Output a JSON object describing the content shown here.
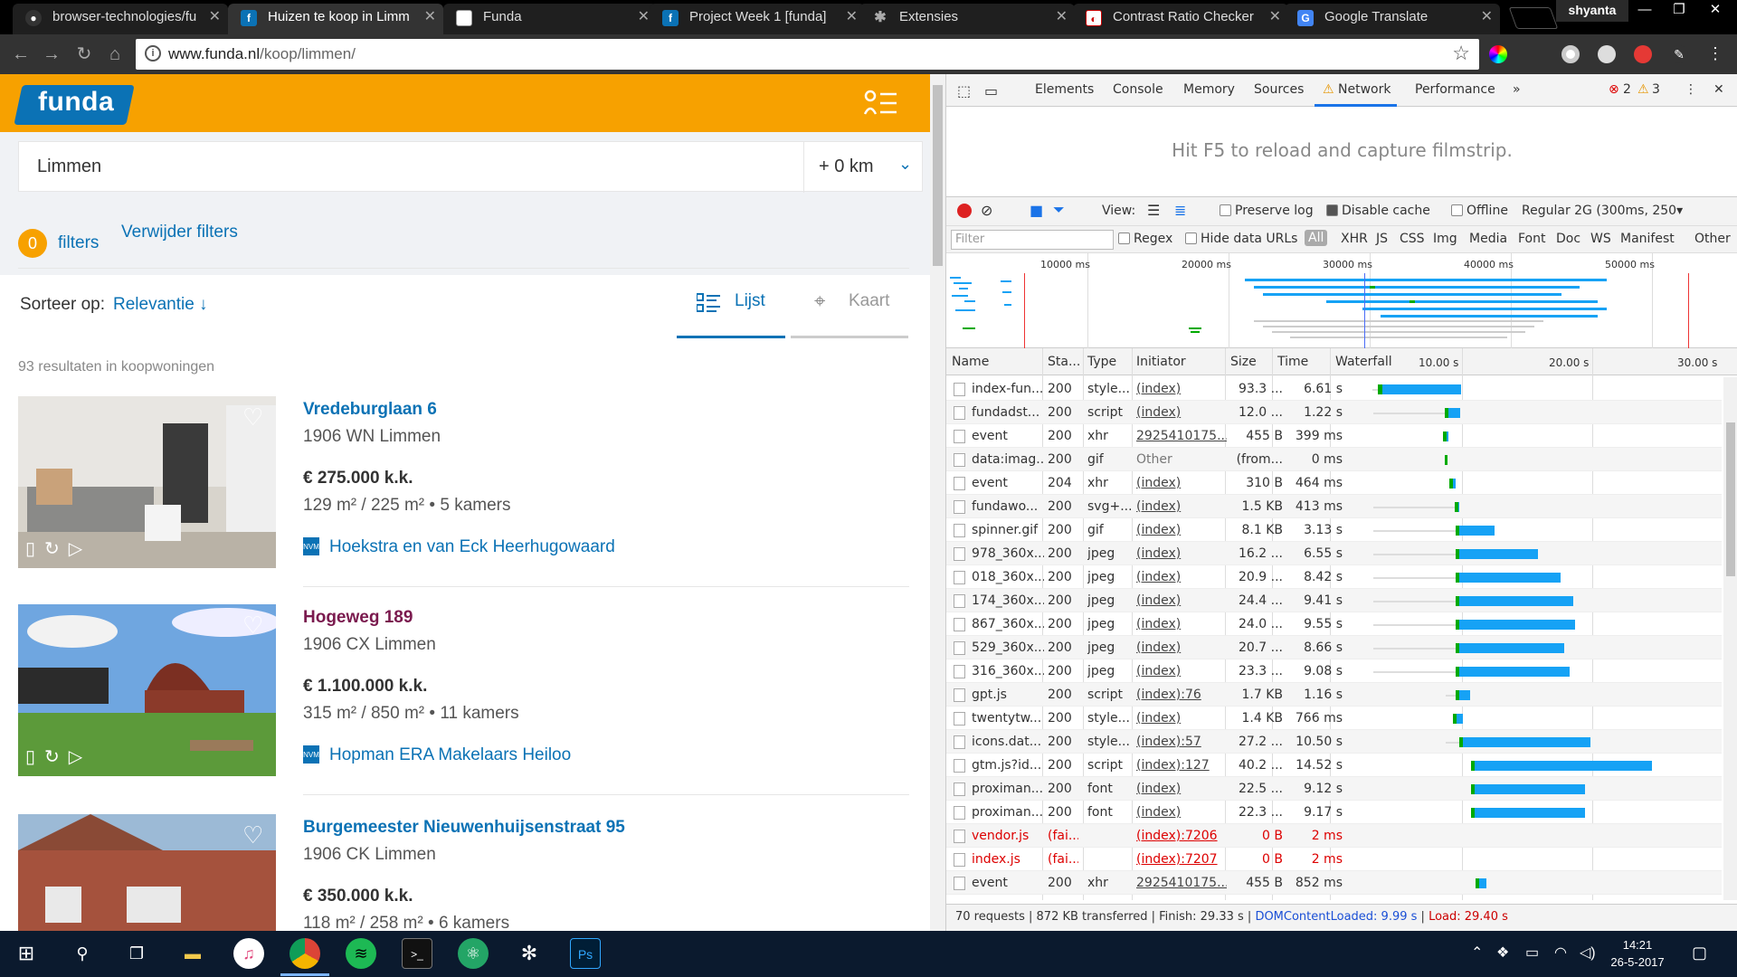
{
  "browser": {
    "tabs": [
      {
        "title": "browser-technologies/fu",
        "icon": "github-icon",
        "active": false
      },
      {
        "title": "Huizen te koop in Limm",
        "icon": "funda-icon",
        "active": true
      },
      {
        "title": "Funda",
        "icon": "page-icon",
        "active": false
      },
      {
        "title": "Project Week 1 [funda]",
        "icon": "funda-icon",
        "active": false
      },
      {
        "title": "Extensies",
        "icon": "puzzle-icon",
        "active": false
      },
      {
        "title": "Contrast Ratio Checker",
        "icon": "contrast-icon",
        "active": false
      },
      {
        "title": "Google Translate",
        "icon": "translate-icon",
        "active": false
      }
    ],
    "profile": "shyanta",
    "url_host": "www.funda.nl",
    "url_path": "/koop/limmen/"
  },
  "funda": {
    "logo": "funda",
    "search_location": "Limmen",
    "radius": "+ 0 km",
    "filter_count": "0",
    "filters_label": "filters",
    "remove_filters": "Verwijder filters",
    "sort_label": "Sorteer op:",
    "sort_value": "Relevantie ↓",
    "view_list": "Lijst",
    "view_map": "Kaart",
    "results": "93 resultaten in koopwoningen",
    "listings": [
      {
        "address": "Vredeburglaan 6",
        "zip": "1906 WN Limmen",
        "price": "€ 275.000 k.k.",
        "living": "129 m²",
        "plot": "225 m²",
        "rooms": "5 kamers",
        "agent": "Hoekstra en van Eck Heerhugowaard",
        "visited": false
      },
      {
        "address": "Hogeweg 189",
        "zip": "1906 CX Limmen",
        "price": "€ 1.100.000 k.k.",
        "living": "315 m²",
        "plot": "850 m²",
        "rooms": "11 kamers",
        "agent": "Hopman ERA Makelaars Heiloo",
        "visited": true
      },
      {
        "address": "Burgemeester Nieuwenhuijsenstraat 95",
        "zip": "1906 CK Limmen",
        "price": "€ 350.000 k.k.",
        "living": "118 m²",
        "plot": "258 m²",
        "rooms": "6 kamers",
        "agent": "",
        "visited": false
      }
    ]
  },
  "devtools": {
    "tabs": [
      "Elements",
      "Console",
      "Memory",
      "Sources",
      "Network",
      "Performance"
    ],
    "active_tab": "Network",
    "errors": "2",
    "warnings": "3",
    "filmstrip_msg": "Hit F5 to reload and capture filmstrip.",
    "toolbar": {
      "view_label": "View:",
      "preserve_log": "Preserve log",
      "disable_cache": "Disable cache",
      "offline": "Offline",
      "throttle": "Regular 2G (300ms, 250"
    },
    "filterbar": {
      "placeholder": "Filter",
      "regex": "Regex",
      "hide_data_urls": "Hide data URLs",
      "types": [
        "All",
        "XHR",
        "JS",
        "CSS",
        "Img",
        "Media",
        "Font",
        "Doc",
        "WS",
        "Manifest",
        "Other"
      ]
    },
    "overview_ticks": [
      "10000 ms",
      "20000 ms",
      "30000 ms",
      "40000 ms",
      "50000 ms"
    ],
    "columns": [
      "Name",
      "Sta...",
      "Type",
      "Initiator",
      "Size",
      "Time",
      "Waterfall"
    ],
    "waterfall_ticks": [
      "10.00 s",
      "20.00 s",
      "30.00 s"
    ],
    "requests": [
      {
        "name": "index-fun...",
        "status": "200",
        "type": "style...",
        "initiator": "(index)",
        "size": "93.3 ...",
        "time": "6.61 s",
        "start": 2.5,
        "wait": 0.5,
        "dur": 6.61,
        "failed": false
      },
      {
        "name": "fundadst...",
        "status": "200",
        "type": "script",
        "initiator": "(index)",
        "size": "12.0 ...",
        "time": "1.22 s",
        "start": 2.6,
        "wait": 5.7,
        "dur": 1.22,
        "failed": false
      },
      {
        "name": "event",
        "status": "200",
        "type": "xhr",
        "initiator": "2925410175...",
        "size": "455 B",
        "time": "399 ms",
        "start": 8.2,
        "wait": 0,
        "dur": 0.4,
        "failed": false
      },
      {
        "name": "data:imag...",
        "status": "200",
        "type": "gif",
        "initiator": "Other",
        "size": "(from...",
        "time": "0 ms",
        "start": 8.3,
        "wait": 0,
        "dur": 0.1,
        "failed": false
      },
      {
        "name": "event",
        "status": "204",
        "type": "xhr",
        "initiator": "(index)",
        "size": "310 B",
        "time": "464 ms",
        "start": 8.7,
        "wait": 0,
        "dur": 0.46,
        "failed": false
      },
      {
        "name": "fundawo...",
        "status": "200",
        "type": "svg+...",
        "initiator": "(index)",
        "size": "1.5 KB",
        "time": "413 ms",
        "start": 2.6,
        "wait": 6.5,
        "dur": 0.41,
        "failed": false
      },
      {
        "name": "spinner.gif",
        "status": "200",
        "type": "gif",
        "initiator": "(index)",
        "size": "8.1 KB",
        "time": "3.13 s",
        "start": 2.6,
        "wait": 6.6,
        "dur": 3.13,
        "failed": false
      },
      {
        "name": "978_360x...",
        "status": "200",
        "type": "jpeg",
        "initiator": "(index)",
        "size": "16.2 ...",
        "time": "6.55 s",
        "start": 2.6,
        "wait": 6.6,
        "dur": 6.55,
        "failed": false
      },
      {
        "name": "018_360x...",
        "status": "200",
        "type": "jpeg",
        "initiator": "(index)",
        "size": "20.9 ...",
        "time": "8.42 s",
        "start": 2.6,
        "wait": 6.6,
        "dur": 8.42,
        "failed": false
      },
      {
        "name": "174_360x...",
        "status": "200",
        "type": "jpeg",
        "initiator": "(index)",
        "size": "24.4 ...",
        "time": "9.41 s",
        "start": 2.6,
        "wait": 6.6,
        "dur": 9.41,
        "failed": false
      },
      {
        "name": "867_360x...",
        "status": "200",
        "type": "jpeg",
        "initiator": "(index)",
        "size": "24.0 ...",
        "time": "9.55 s",
        "start": 2.6,
        "wait": 6.6,
        "dur": 9.55,
        "failed": false
      },
      {
        "name": "529_360x...",
        "status": "200",
        "type": "jpeg",
        "initiator": "(index)",
        "size": "20.7 ...",
        "time": "8.66 s",
        "start": 2.6,
        "wait": 6.6,
        "dur": 8.66,
        "failed": false
      },
      {
        "name": "316_360x...",
        "status": "200",
        "type": "jpeg",
        "initiator": "(index)",
        "size": "23.3 ...",
        "time": "9.08 s",
        "start": 2.6,
        "wait": 6.6,
        "dur": 9.08,
        "failed": false
      },
      {
        "name": "gpt.js",
        "status": "200",
        "type": "script",
        "initiator": "(index):76",
        "size": "1.7 KB",
        "time": "1.16 s",
        "start": 8.4,
        "wait": 0.8,
        "dur": 1.16,
        "failed": false
      },
      {
        "name": "twentytw...",
        "status": "200",
        "type": "style...",
        "initiator": "(index)",
        "size": "1.4 KB",
        "time": "766 ms",
        "start": 9.0,
        "wait": 0,
        "dur": 0.77,
        "failed": false
      },
      {
        "name": "icons.dat...",
        "status": "200",
        "type": "style...",
        "initiator": "(index):57",
        "size": "27.2 ...",
        "time": "10.50 s",
        "start": 8.4,
        "wait": 1.1,
        "dur": 10.5,
        "failed": false
      },
      {
        "name": "gtm.js?id...",
        "status": "200",
        "type": "script",
        "initiator": "(index):127",
        "size": "40.2 ...",
        "time": "14.52 s",
        "start": 10.4,
        "wait": 0,
        "dur": 14.52,
        "failed": false
      },
      {
        "name": "proximan...",
        "status": "200",
        "type": "font",
        "initiator": "(index)",
        "size": "22.5 ...",
        "time": "9.12 s",
        "start": 10.4,
        "wait": 0,
        "dur": 9.12,
        "failed": false
      },
      {
        "name": "proximan...",
        "status": "200",
        "type": "font",
        "initiator": "(index)",
        "size": "22.3 ...",
        "time": "9.17 s",
        "start": 10.4,
        "wait": 0,
        "dur": 9.17,
        "failed": false
      },
      {
        "name": "vendor.js",
        "status": "(fai...",
        "type": "",
        "initiator": "(index):7206",
        "size": "0 B",
        "time": "2 ms",
        "start": 0,
        "wait": 0,
        "dur": 0,
        "failed": true
      },
      {
        "name": "index.js",
        "status": "(fai...",
        "type": "",
        "initiator": "(index):7207",
        "size": "0 B",
        "time": "2 ms",
        "start": 0,
        "wait": 0,
        "dur": 0,
        "failed": true
      },
      {
        "name": "event",
        "status": "200",
        "type": "xhr",
        "initiator": "2925410175...",
        "size": "455 B",
        "time": "852 ms",
        "start": 10.8,
        "wait": 0,
        "dur": 0.85,
        "failed": false
      }
    ],
    "status": {
      "requests": "70 requests",
      "transferred": "872 KB transferred",
      "finish": "Finish: 29.33 s",
      "dcl": "DOMContentLoaded: 9.99 s",
      "load": "Load: 29.40 s"
    }
  },
  "taskbar": {
    "time": "14:21",
    "date": "26-5-2017"
  }
}
